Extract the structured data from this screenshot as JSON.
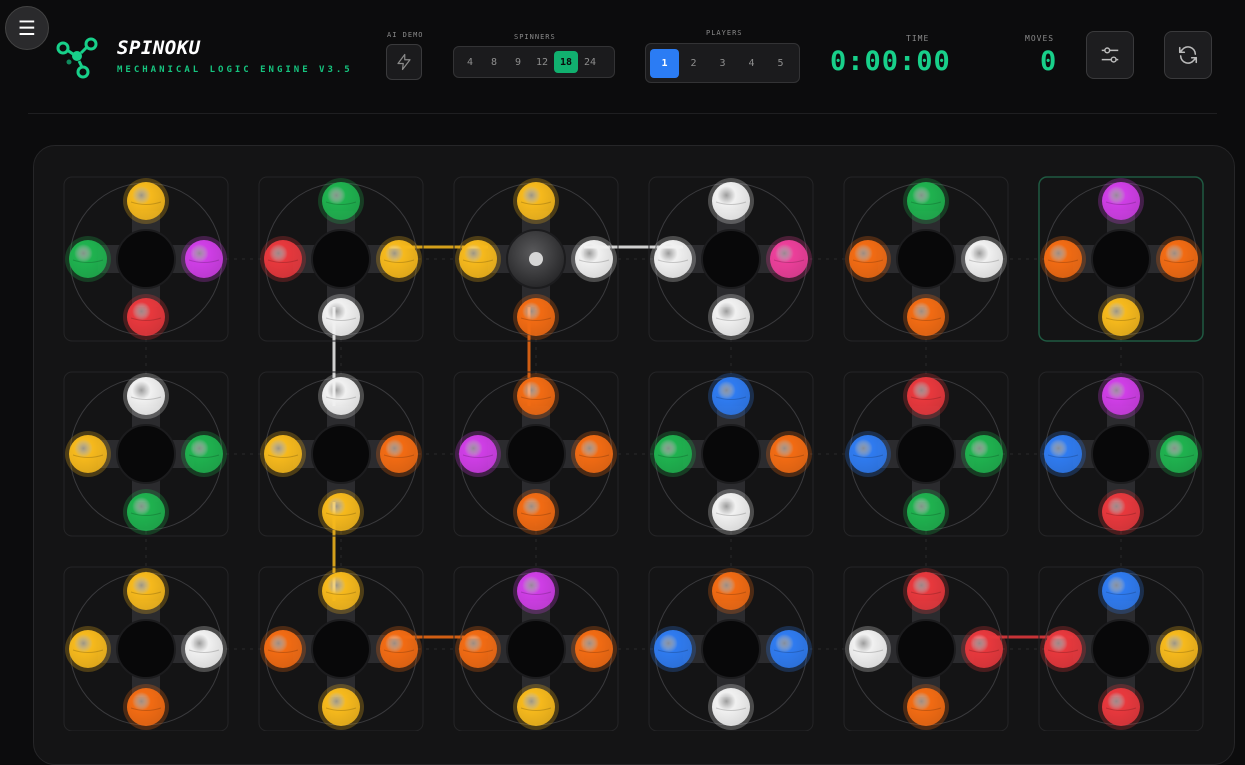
{
  "header": {
    "title": "SPINOKU",
    "subtitle": "MECHANICAL LOGIC ENGINE V3.5",
    "ai_demo_label": "AI DEMO",
    "spinners_label": "SPINNERS",
    "spinner_options": [
      "4",
      "8",
      "9",
      "12",
      "18",
      "24"
    ],
    "spinner_selected": "18",
    "players_label": "PLAYERS",
    "player_options": [
      "1",
      "2",
      "3",
      "4",
      "5"
    ],
    "player_selected": "1",
    "time_label": "TIME",
    "time_value": "0:00:00",
    "moves_label": "MOVES",
    "moves_value": "0"
  },
  "icons": {
    "menu": "menu-icon",
    "logo": "fidget-spinner-logo-icon",
    "ai": "lightning-icon",
    "settings": "sliders-icon",
    "reset": "refresh-icon"
  },
  "menu_glyph": "☰",
  "colors": {
    "accent": "#18d08a",
    "yellow": "#f6b91c",
    "green": "#1fb24f",
    "purple": "#cf3ee6",
    "red": "#e8383d",
    "white": "#f1f1f1",
    "orange": "#f26b13",
    "pink": "#ec3f9a",
    "blue": "#2f7bf0"
  },
  "board": {
    "rows": 3,
    "cols": 6,
    "selected_spinner": [
      0,
      5
    ],
    "active_hub": [
      0,
      2
    ],
    "spinners": [
      [
        {
          "top": "yellow",
          "right": "purple",
          "bottom": "red",
          "left": "green"
        },
        {
          "top": "green",
          "right": "yellow",
          "bottom": "white",
          "left": "red"
        },
        {
          "top": "yellow",
          "right": "white",
          "bottom": "orange",
          "left": "yellow"
        },
        {
          "top": "white",
          "right": "pink",
          "bottom": "white",
          "left": "white"
        },
        {
          "top": "green",
          "right": "white",
          "bottom": "orange",
          "left": "orange"
        },
        {
          "top": "purple",
          "right": "orange",
          "bottom": "yellow",
          "left": "orange"
        }
      ],
      [
        {
          "top": "white",
          "right": "green",
          "bottom": "green",
          "left": "yellow"
        },
        {
          "top": "white",
          "right": "orange",
          "bottom": "yellow",
          "left": "yellow"
        },
        {
          "top": "orange",
          "right": "orange",
          "bottom": "orange",
          "left": "purple"
        },
        {
          "top": "blue",
          "right": "orange",
          "bottom": "white",
          "left": "green"
        },
        {
          "top": "red",
          "right": "green",
          "bottom": "green",
          "left": "blue"
        },
        {
          "top": "purple",
          "right": "green",
          "bottom": "red",
          "left": "blue"
        }
      ],
      [
        {
          "top": "yellow",
          "right": "white",
          "bottom": "orange",
          "left": "yellow"
        },
        {
          "top": "yellow",
          "right": "orange",
          "bottom": "yellow",
          "left": "orange"
        },
        {
          "top": "purple",
          "right": "orange",
          "bottom": "yellow",
          "left": "orange"
        },
        {
          "top": "orange",
          "right": "blue",
          "bottom": "white",
          "left": "blue"
        },
        {
          "top": "red",
          "right": "red",
          "bottom": "orange",
          "left": "white"
        },
        {
          "top": "blue",
          "right": "yellow",
          "bottom": "red",
          "left": "red"
        }
      ]
    ],
    "links": [
      {
        "from": [
          0,
          1
        ],
        "to": [
          0,
          2
        ],
        "dir": "h",
        "color": "yellow"
      },
      {
        "from": [
          0,
          2
        ],
        "to": [
          0,
          3
        ],
        "dir": "h",
        "color": "white"
      },
      {
        "from": [
          0,
          1
        ],
        "to": [
          1,
          1
        ],
        "dir": "v",
        "color": "white"
      },
      {
        "from": [
          0,
          2
        ],
        "to": [
          1,
          2
        ],
        "dir": "v",
        "color": "orange"
      },
      {
        "from": [
          1,
          1
        ],
        "to": [
          2,
          1
        ],
        "dir": "v",
        "color": "yellow"
      },
      {
        "from": [
          2,
          1
        ],
        "to": [
          2,
          2
        ],
        "dir": "h",
        "color": "orange"
      },
      {
        "from": [
          2,
          4
        ],
        "to": [
          2,
          5
        ],
        "dir": "h",
        "color": "red"
      }
    ]
  }
}
